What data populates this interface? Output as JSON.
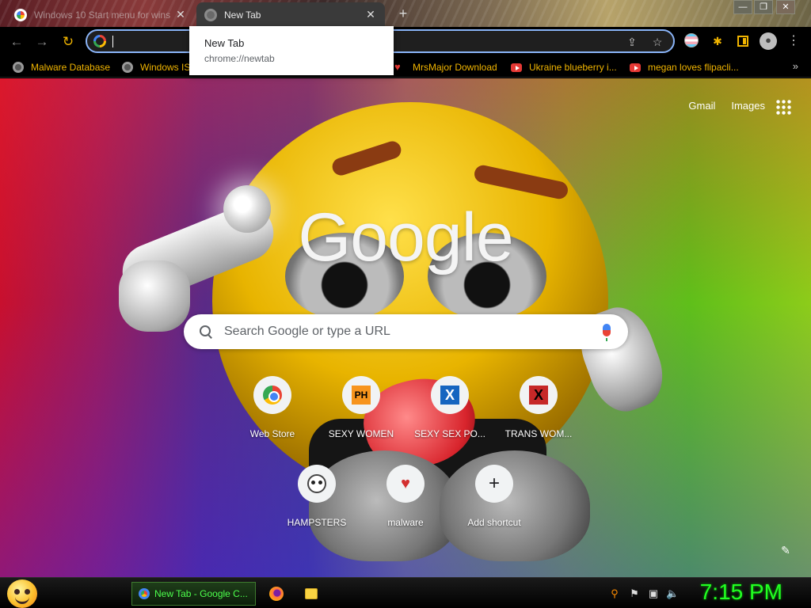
{
  "tabs": [
    {
      "title": "Windows 10 Start menu for wins",
      "active": false
    },
    {
      "title": "New Tab",
      "active": true
    }
  ],
  "tab_close_glyph": "✕",
  "new_tab_glyph": "+",
  "window_controls": [
    "—",
    "❐",
    "✕"
  ],
  "hover_card": {
    "title": "New Tab",
    "url": "chrome://newtab"
  },
  "omnibox": {
    "value": "",
    "placeholder": ""
  },
  "bookmarks": [
    {
      "label": "Malware Database",
      "icon": "globe-icon"
    },
    {
      "label": "Windows IS",
      "icon": "globe-icon"
    },
    {
      "label": "MrsMajor Download",
      "icon": "heart-icon"
    },
    {
      "label": "Ukraine blueberry i...",
      "icon": "youtube-icon"
    },
    {
      "label": "megan loves flipacli...",
      "icon": "youtube-icon"
    }
  ],
  "bookmarks_more": "»",
  "ntp": {
    "links": {
      "gmail": "Gmail",
      "images": "Images"
    },
    "logo": "Google",
    "search_placeholder": "Search Google or type a URL",
    "shortcuts": [
      {
        "label": "Web Store",
        "icon": "web-store-icon"
      },
      {
        "label": "SEXY WOMEN",
        "icon_text": "PH"
      },
      {
        "label": "SEXY SEX PO...",
        "icon_text": "X"
      },
      {
        "label": "TRANS WOM...",
        "icon_text": "X"
      },
      {
        "label": "HAMPSTERS",
        "icon": "hamster-icon"
      },
      {
        "label": "malware",
        "icon_text": "♥"
      },
      {
        "label": "Add shortcut",
        "icon_text": "+"
      }
    ]
  },
  "taskbar": {
    "task_label": "New Tab - Google C...",
    "clock": "7:15 PM"
  },
  "colors": {
    "accent_yellow": "#f0b400",
    "omnibox_focus": "#8ab4f8",
    "taskbar_text": "#4cff4c",
    "clock_green": "#22ff22"
  }
}
